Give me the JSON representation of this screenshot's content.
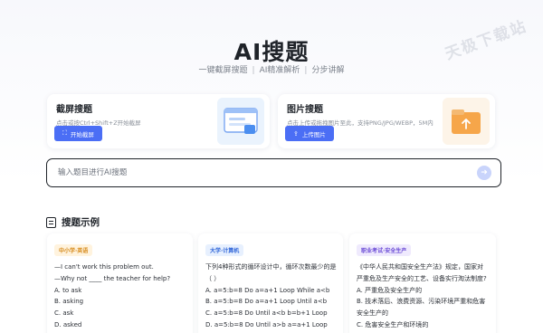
{
  "watermark": "天极下载站",
  "header": {
    "title": "AI搜题",
    "features": [
      "一键截屏搜题",
      "AI精准解析",
      "分步讲解"
    ],
    "separator": "|"
  },
  "cards": {
    "screenshot": {
      "title": "截屏搜题",
      "desc": "点击或按Ctrl+Shift+Z开始截屏",
      "button": "开始截屏",
      "button_icon": "scan-icon"
    },
    "image": {
      "title": "图片搜题",
      "desc": "点击上传或拖拽图片至此，支持PNG/JPG/WEBP，5M内",
      "button": "上传图片",
      "button_icon": "upload-icon"
    }
  },
  "search": {
    "placeholder": "输入题目进行AI搜题",
    "submit_icon": "arrow-right-icon"
  },
  "examples": {
    "title": "搜题示例",
    "items": [
      {
        "tag": "中小学·英语",
        "lines": [
          "—I can't work this problem out.",
          "—Why not ____ the teacher for help?",
          "A. to ask",
          "B. asking",
          "C. ask",
          "D. asked"
        ]
      },
      {
        "tag": "大学·计算机",
        "lines": [
          "下列4种形式的循环设计中，循环次数最少的是",
          "（ ）",
          "A. a=5:b=8 Do a=a+1 Loop While a<b",
          "B. a=5:b=8 Do a=a+1 Loop Until a<b",
          "C. a=5:b=8 Do Until a<b b=b+1 Loop",
          "D. a=5:b=8 Do Until a>b a=a+1 Loop"
        ]
      },
      {
        "tag": "职业考试·安全生产",
        "lines": [
          "《中华人民共和国安全生产法》规定，国家对严重危及生产安全的工艺、设备实行淘汰制度?",
          "A. 严重危及安全生产的",
          "B. 技术落后、浪费资源、污染环境严重和危害安全生产的",
          "C. 危害安全生产和环境的"
        ]
      }
    ]
  },
  "colors": {
    "accent": "#4b6ef5",
    "text": "#1f2329"
  }
}
